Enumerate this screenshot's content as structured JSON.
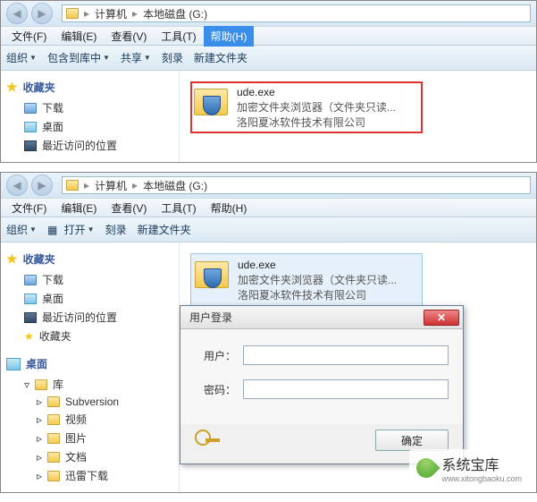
{
  "top": {
    "breadcrumb": {
      "computer": "计算机",
      "sep": "▸",
      "drive": "本地磁盘 (G:)"
    },
    "menus": {
      "file": "文件(F)",
      "edit": "编辑(E)",
      "view": "查看(V)",
      "tools": "工具(T)",
      "help": "帮助(H)"
    },
    "toolbar": {
      "organize": "组织",
      "include": "包含到库中",
      "share": "共享",
      "burn": "刻录",
      "newfolder": "新建文件夹"
    },
    "sidebar": {
      "fav": "收藏夹",
      "downloads": "下载",
      "desktop": "桌面",
      "recent": "最近访问的位置"
    },
    "file": {
      "name": "ude.exe",
      "line1": "加密文件夹浏览器（文件夹只读...",
      "line2": "洛阳夏冰软件技术有限公司"
    }
  },
  "bottom": {
    "breadcrumb": {
      "computer": "计算机",
      "sep": "▸",
      "drive": "本地磁盘 (G:)"
    },
    "menus": {
      "file": "文件(F)",
      "edit": "编辑(E)",
      "view": "查看(V)",
      "tools": "工具(T)",
      "help": "帮助(H)"
    },
    "toolbar": {
      "organize": "组织",
      "open": "打开",
      "burn": "刻录",
      "newfolder": "新建文件夹"
    },
    "sidebar": {
      "fav": "收藏夹",
      "downloads": "下载",
      "desktop": "桌面",
      "recent": "最近访问的位置",
      "fav2": "收藏夹",
      "desktop2": "桌面",
      "library": "库",
      "subversion": "Subversion",
      "video": "视频",
      "pictures": "图片",
      "documents": "文档",
      "swdl": "迅雷下载"
    },
    "file": {
      "name": "ude.exe",
      "line1": "加密文件夹浏览器（文件夹只读...",
      "line2": "洛阳夏冰软件技术有限公司"
    },
    "dialog": {
      "title": "用户登录",
      "user": "用户：",
      "pass": "密码：",
      "ok": "确定"
    }
  },
  "watermark": "系统宝库",
  "watermark_url": "www.xitongbaoku.com"
}
